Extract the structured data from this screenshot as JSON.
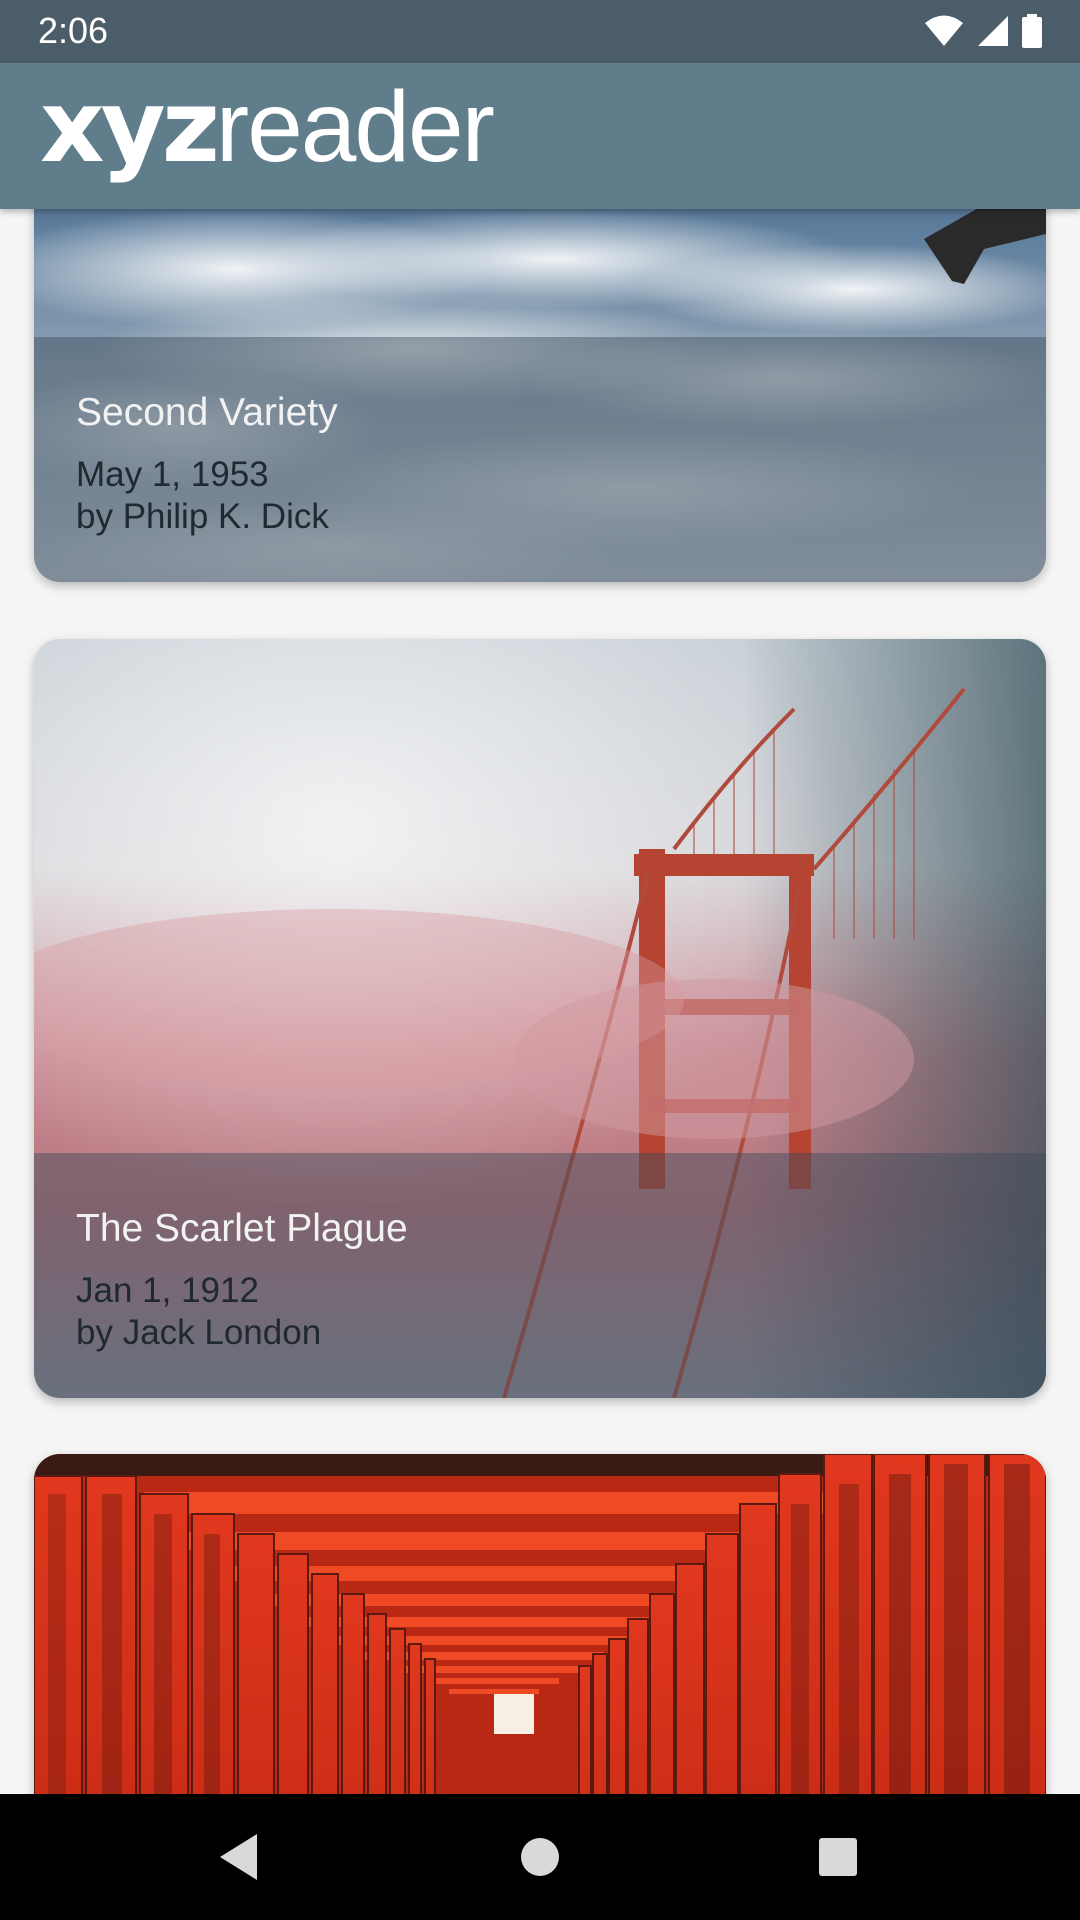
{
  "status": {
    "time": "2:06"
  },
  "appbar": {
    "logo_bold": "xyz",
    "logo_light": "reader"
  },
  "articles": [
    {
      "title": "Second Variety",
      "date": "May 1, 1953",
      "author": "by Philip K. Dick"
    },
    {
      "title": "The Scarlet Plague",
      "date": "Jan 1, 1912",
      "author": "by Jack London"
    }
  ],
  "colors": {
    "statusbar": "#4a5d69",
    "appbar": "#607d8b",
    "background": "#f5f5f5"
  }
}
